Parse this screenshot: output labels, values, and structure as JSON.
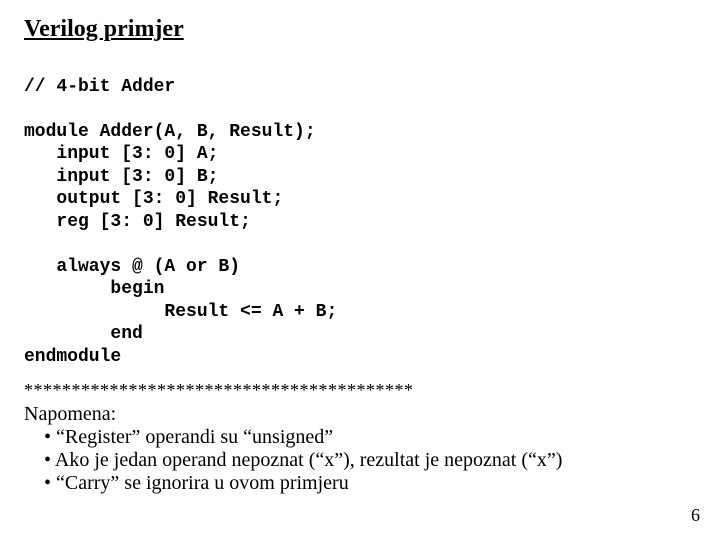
{
  "title": "Verilog primjer",
  "code": {
    "l1": "// 4-bit Adder",
    "l2": "module Adder(A, B, Result);",
    "l3": "   input [3: 0] A;",
    "l4": "   input [3: 0] B;",
    "l5": "   output [3: 0] Result;",
    "l6": "   reg [3: 0] Result;",
    "l7": "   always @ (A or B)",
    "l8": "        begin",
    "l9": "             Result <= A + B;",
    "l10": "        end",
    "l11": "endmodule"
  },
  "separator": "*****************************************",
  "note_heading": "Napomena:",
  "notes": {
    "n1": "“Register” operandi su “unsigned”",
    "n2": "Ako je jedan operand nepoznat (“x”), rezultat je nepoznat (“x”)",
    "n3": "“Carry” se ignorira u ovom primjeru"
  },
  "page_number": "6"
}
